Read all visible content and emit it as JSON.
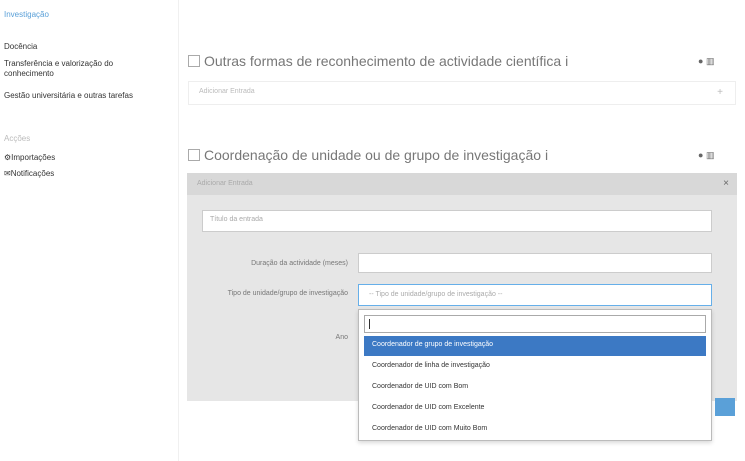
{
  "sidebar": {
    "items": [
      {
        "label": "Investigação",
        "active": true
      },
      {
        "label": "Docência",
        "active": false
      },
      {
        "label": "Transferência e valorização do conhecimento",
        "active": false
      },
      {
        "label": "Gestão universitária e outras tarefas",
        "active": false
      }
    ],
    "section_label": "Acções",
    "actions": [
      {
        "icon": "gear-icon",
        "label": "Importações"
      },
      {
        "icon": "inbox-icon",
        "label": "Notificações"
      }
    ]
  },
  "sections": [
    {
      "title": "Outras formas de reconhecimento de actividade científica",
      "suffix": "i",
      "add_label": "Adicionar Entrada"
    },
    {
      "title": "Coordenação de unidade ou de grupo de investigação",
      "suffix": "i"
    }
  ],
  "panel": {
    "header": "Adicionar Entrada",
    "close_glyph": "×",
    "title_placeholder": "Título da entrada",
    "duration_label": "Duração da actividade (meses)",
    "unit_type_label": "Tipo de unidade/grupo de investigação",
    "unit_type_placeholder": "-- Tipo de unidade/grupo de investigação --",
    "year_label": "Ano"
  },
  "dropdown": {
    "options": [
      {
        "label": "Coordenador de grupo de investigação",
        "selected": true
      },
      {
        "label": "Coordenador de linha de investigação",
        "selected": false
      },
      {
        "label": "Coordenador de UID com Bom",
        "selected": false
      },
      {
        "label": "Coordenador de UID com Excelente",
        "selected": false
      },
      {
        "label": "Coordenador de UID com Muito Bom",
        "selected": false
      }
    ]
  },
  "colors": {
    "accent": "#5aa0d8",
    "selected": "#3c79c4",
    "panel_bg": "#e6e6e6"
  }
}
